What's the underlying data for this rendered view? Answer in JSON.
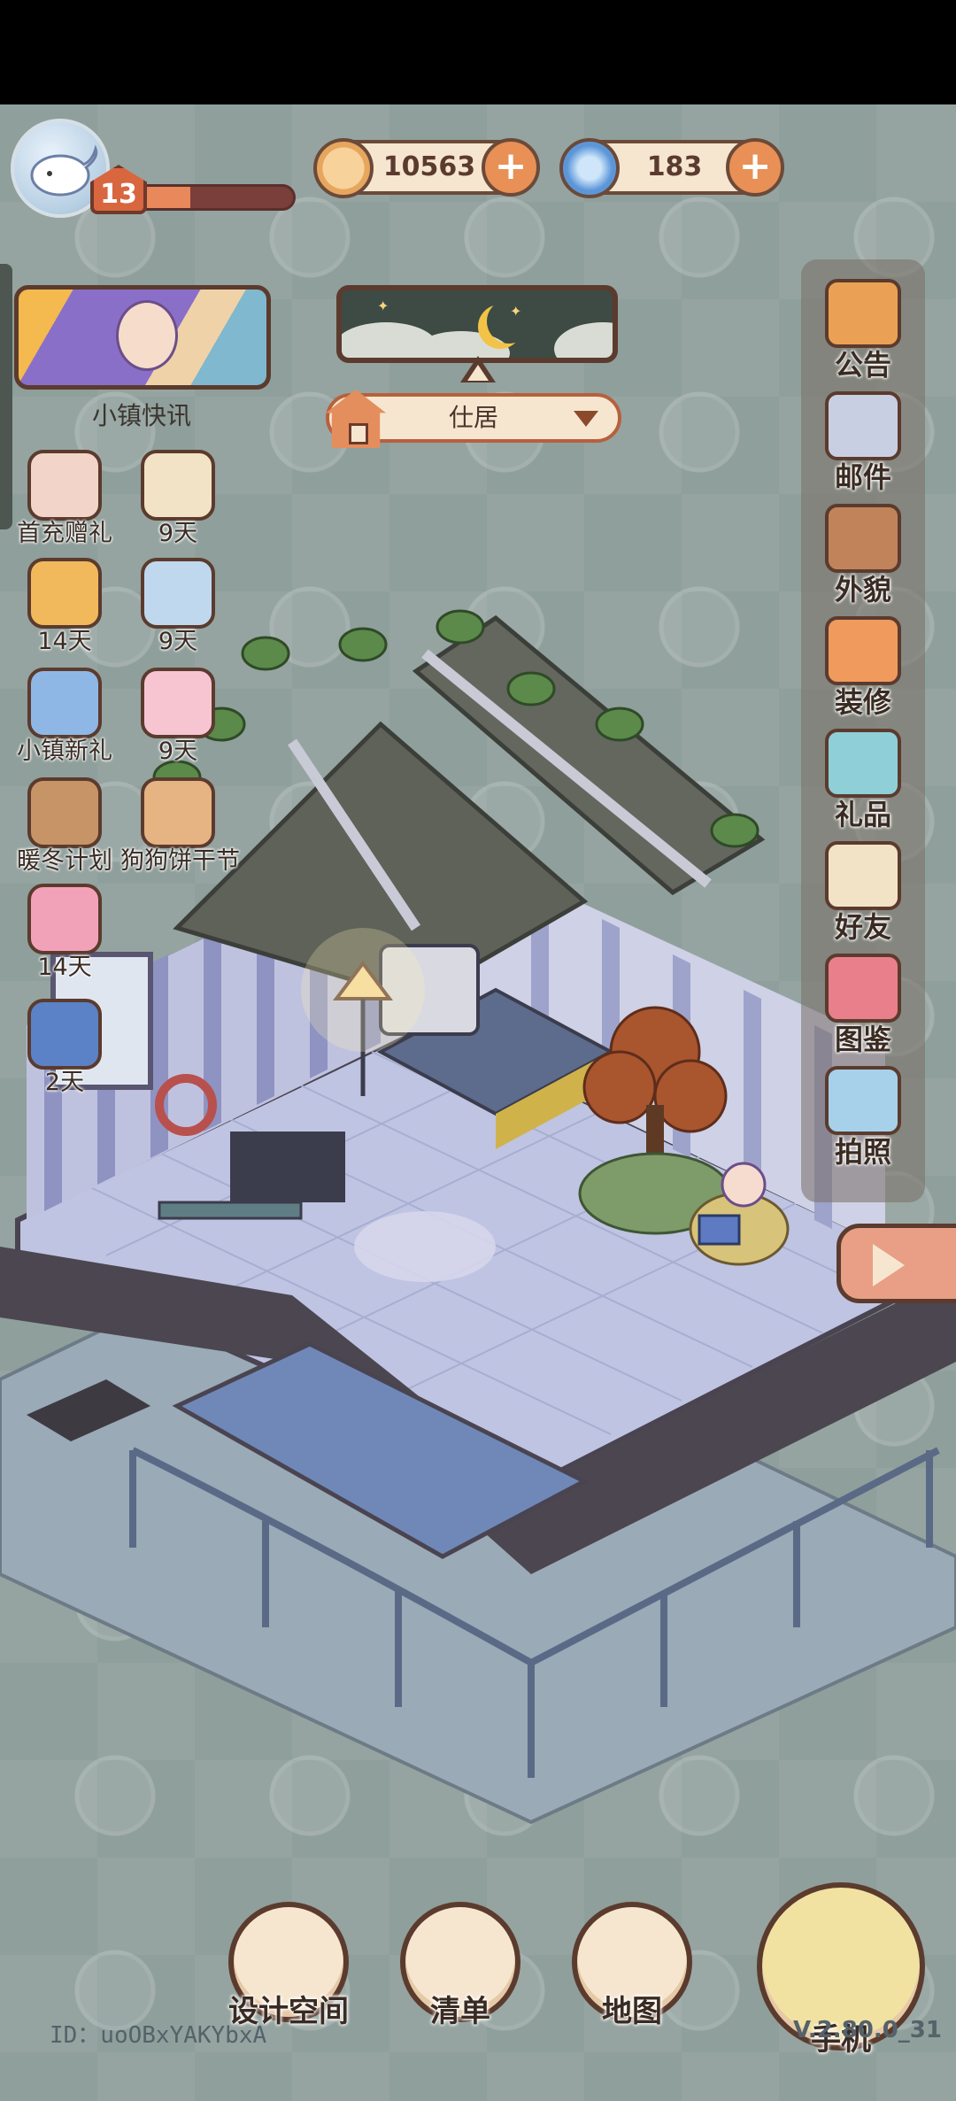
{
  "player": {
    "level": "13",
    "xp_progress": 0.35,
    "id_text": "ID：uoOBxYAKYbxA",
    "version": "V.2.80.0_31"
  },
  "currencies": [
    {
      "name": "coin",
      "icon": "coin-icon",
      "value": "10563",
      "color": "#f3c27d"
    },
    {
      "name": "gem",
      "icon": "swirl-icon",
      "value": "183",
      "color": "#6aa6e2"
    }
  ],
  "news": {
    "label": "小镇快讯"
  },
  "time_of_day": {
    "icon": "moon-icon",
    "state": "night"
  },
  "location": {
    "label": "仕居"
  },
  "events": [
    {
      "label": "首充赠礼",
      "icon": "gift-box-icon",
      "color": "#f2d4c9"
    },
    {
      "label": "9天",
      "icon": "letter-quill-icon",
      "color": "#f3e3c6"
    },
    {
      "label": "14天",
      "icon": "triangle-ruler-icon",
      "color": "#f2b95c"
    },
    {
      "label": "9天",
      "icon": "flower-box-icon",
      "color": "#bfd8ee"
    },
    {
      "label": "小镇新礼",
      "icon": "rose-card-icon",
      "color": "#8fb7e6"
    },
    {
      "label": "9天",
      "icon": "kimono-icon",
      "color": "#f7c5d2"
    },
    {
      "label": "暖冬计划",
      "icon": "dog-icon",
      "color": "#c79468"
    },
    {
      "label": "狗狗饼干节",
      "icon": "bone-icon",
      "color": "#e6b383"
    },
    {
      "label": "14天",
      "icon": "ribbon-icon",
      "color": "#f2a2b8"
    },
    {
      "label": "2天",
      "icon": "trophy-icon",
      "color": "#5b82c7"
    }
  ],
  "right_menu": [
    {
      "label": "公告",
      "icon": "megaphone-icon",
      "color": "#eaa155"
    },
    {
      "label": "邮件",
      "icon": "mail-icon",
      "color": "#c9cfe3"
    },
    {
      "label": "外貌",
      "icon": "face-icon",
      "color": "#c1845a"
    },
    {
      "label": "装修",
      "icon": "house-wrench-icon",
      "color": "#f09a5e"
    },
    {
      "label": "礼品",
      "icon": "present-icon",
      "color": "#8fd0d8"
    },
    {
      "label": "好友",
      "icon": "contacts-icon",
      "color": "#f3e3c6"
    },
    {
      "label": "图鉴",
      "icon": "album-icon",
      "color": "#e97f8a"
    },
    {
      "label": "拍照",
      "icon": "camera-icon",
      "color": "#a7d1ea"
    }
  ],
  "expand_button": {
    "icon": "play-icon"
  },
  "bottom_nav": [
    {
      "label": "设计空间",
      "icon": "design-ruler-icon"
    },
    {
      "label": "清单",
      "icon": "checklist-icon"
    },
    {
      "label": "地图",
      "icon": "map-pin-icon"
    },
    {
      "label": "手机",
      "icon": "phone-icon"
    }
  ]
}
